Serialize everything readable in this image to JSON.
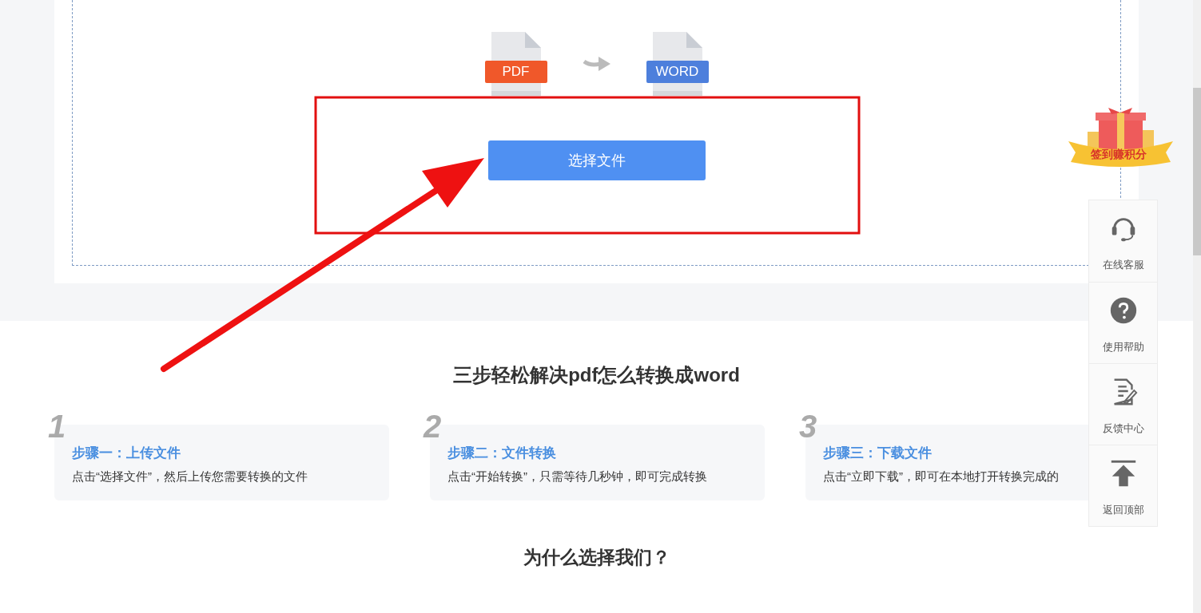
{
  "converter": {
    "source_format": "PDF",
    "target_format": "WORD",
    "button": "选择文件"
  },
  "steps_section": {
    "title": "三步轻松解决pdf怎么转换成word",
    "steps": [
      {
        "number": "1",
        "title": "步骤一：上传文件",
        "description": "点击“选择文件”，然后上传您需要转换的文件"
      },
      {
        "number": "2",
        "title": "步骤二：文件转换",
        "description": "点击“开始转换”，只需等待几秒钟，即可完成转换"
      },
      {
        "number": "3",
        "title": "步骤三：下载文件",
        "description": "点击“立即下载”，即可在本地打开转换完成的"
      }
    ]
  },
  "why_section": {
    "title": "为什么选择我们？"
  },
  "promo_badge": {
    "label": "签到赚积分"
  },
  "floating_toolbar": [
    {
      "kind": "headset",
      "label": "在线客服"
    },
    {
      "kind": "help",
      "label": "使用帮助"
    },
    {
      "kind": "feedback",
      "label": "反馈中心"
    },
    {
      "kind": "top",
      "label": "返回顶部"
    }
  ]
}
